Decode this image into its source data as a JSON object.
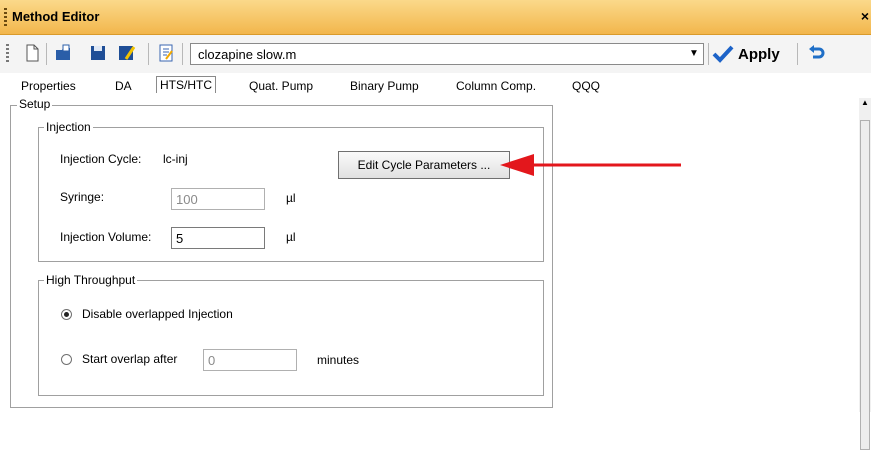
{
  "window": {
    "title": "Method Editor",
    "close_glyph": "×"
  },
  "toolbar": {
    "icons": [
      "new-document-icon",
      "open-folder-icon",
      "save-icon",
      "save-as-icon",
      "edit-notes-icon"
    ],
    "method_file": "clozapine slow.m",
    "apply_label": "Apply",
    "undo_icon": "undo-icon"
  },
  "tabs": [
    {
      "label": "Properties"
    },
    {
      "label": "DA"
    },
    {
      "label": "HTS/HTC",
      "active": true
    },
    {
      "label": "Quat. Pump"
    },
    {
      "label": "Binary Pump"
    },
    {
      "label": "Column Comp."
    },
    {
      "label": "QQQ"
    }
  ],
  "setup": {
    "legend": "Setup",
    "injection": {
      "legend": "Injection",
      "cycle_label": "Injection Cycle:",
      "cycle_value": "lc-inj",
      "edit_button": "Edit Cycle Parameters ...",
      "syringe_label": "Syringe:",
      "syringe_value": "100",
      "syringe_unit": "µl",
      "volume_label": "Injection Volume:",
      "volume_value": "5",
      "volume_unit": "µl"
    },
    "high_throughput": {
      "legend": "High Throughput",
      "option_disable": "Disable overlapped Injection",
      "option_start": "Start overlap after",
      "overlap_value": "0",
      "overlap_unit": "minutes",
      "selected": "disable"
    }
  },
  "annotation": {
    "arrow_color": "#e3171c"
  }
}
